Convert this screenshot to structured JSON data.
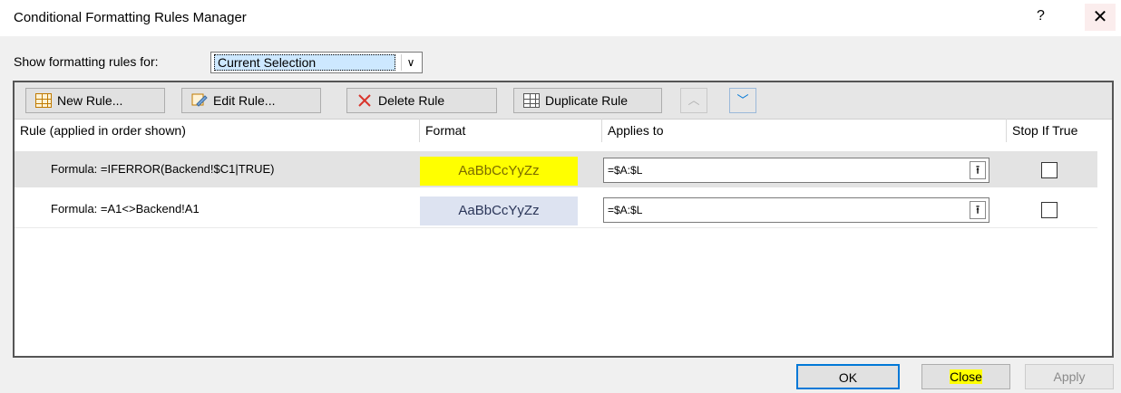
{
  "window": {
    "title": "Conditional Formatting Rules Manager",
    "help_label": "?",
    "close_label": "✕"
  },
  "show_rules": {
    "label": "Show formatting rules for:",
    "selected": "Current Selection",
    "arrow": "∨"
  },
  "toolbar": {
    "new_rule": "New Rule...",
    "edit_rule": "Edit Rule...",
    "delete_rule": "Delete Rule",
    "duplicate_rule": "Duplicate Rule",
    "move_up": "︿",
    "move_down": "﹀"
  },
  "table": {
    "headers": [
      "Rule (applied in order shown)",
      "Format",
      "Applies to",
      "Stop If True"
    ],
    "rows": [
      {
        "rule": "Formula: =IFERROR(Backend!$C1|TRUE)",
        "format_preview": "AaBbCcYyZz",
        "format_bg": "#ffff00",
        "applies_to": "=$A:$L",
        "stop_if_true": false
      },
      {
        "rule": "Formula: =A1<>Backend!A1",
        "format_preview": "AaBbCcYyZz",
        "format_bg": "#dde3f1",
        "applies_to": "=$A:$L",
        "stop_if_true": false
      }
    ]
  },
  "buttons": {
    "ok": "OK",
    "close": "Close",
    "apply": "Apply"
  },
  "collapse_icon": "⭱",
  "colors": {
    "accent": "#0078d7",
    "highlight": "#ffff00"
  }
}
